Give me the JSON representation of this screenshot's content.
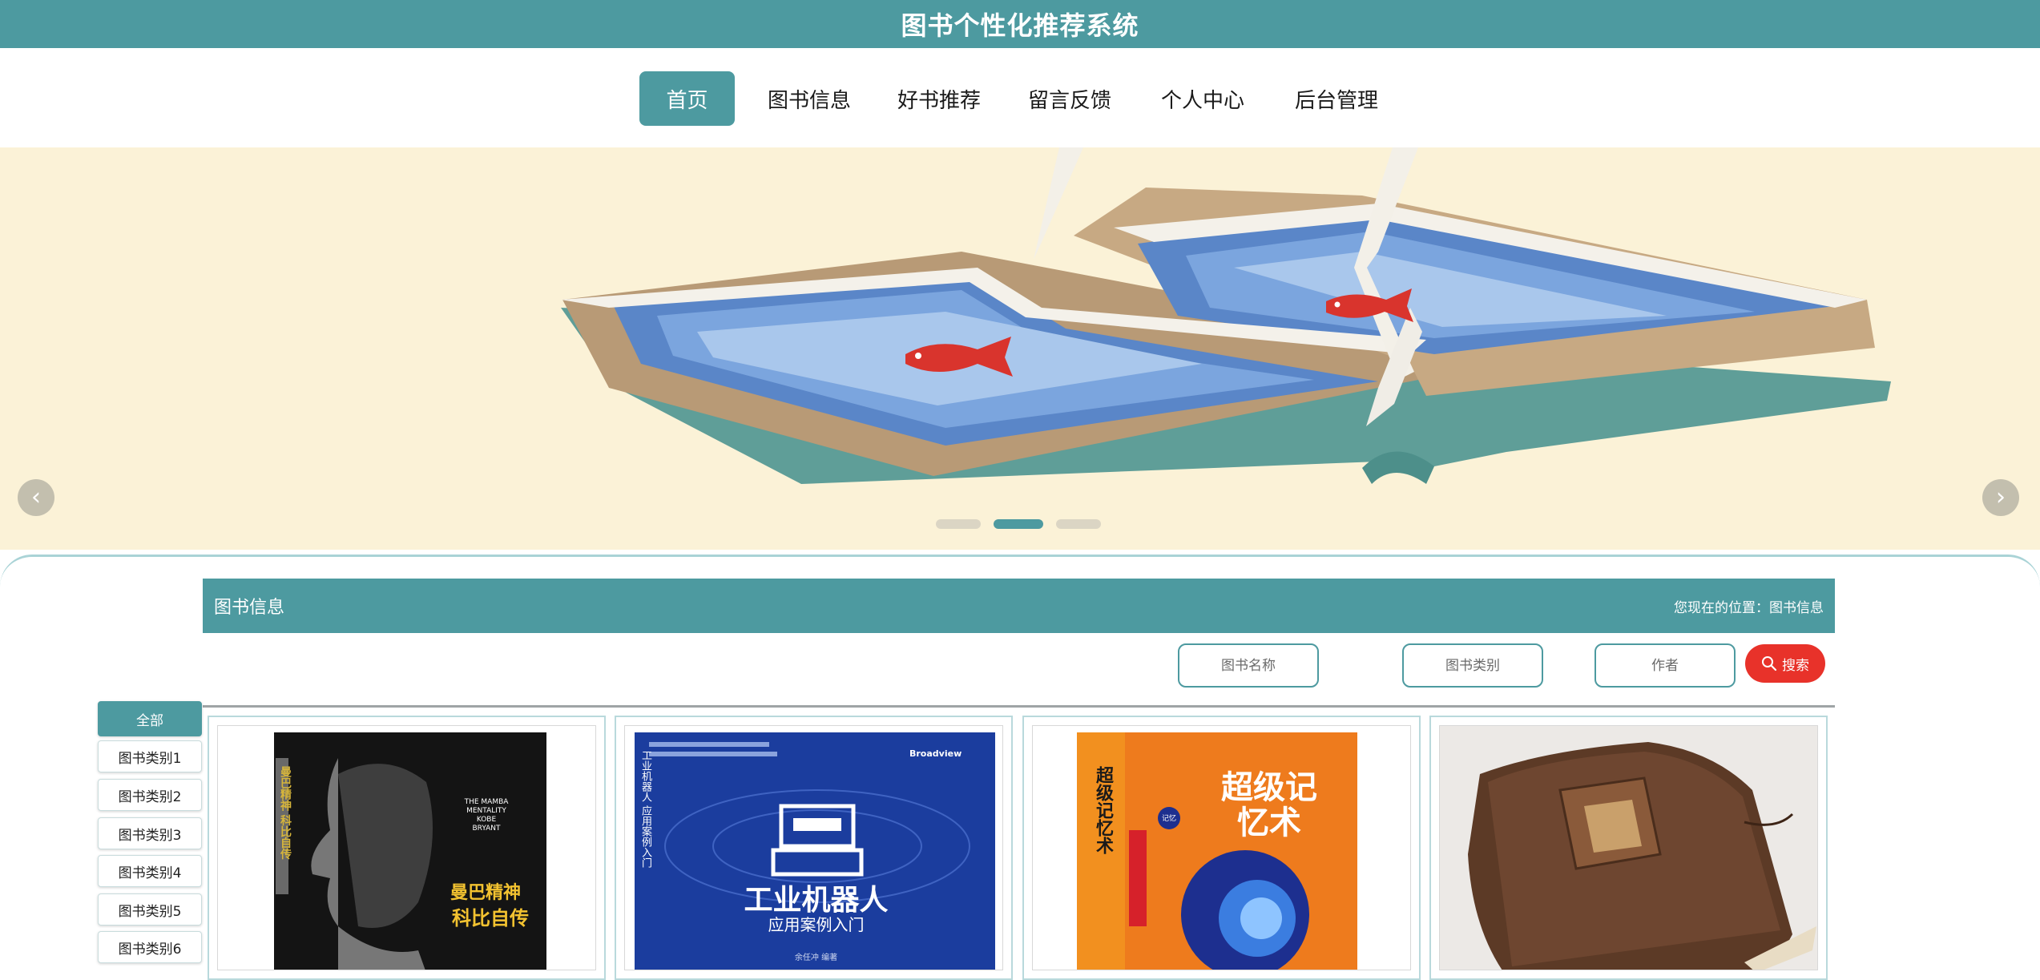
{
  "site": {
    "title": "图书个性化推荐系统"
  },
  "nav": {
    "items": [
      {
        "label": "首页",
        "active": true
      },
      {
        "label": "图书信息",
        "active": false
      },
      {
        "label": "好书推荐",
        "active": false
      },
      {
        "label": "留言反馈",
        "active": false
      },
      {
        "label": "个人中心",
        "active": false
      },
      {
        "label": "后台管理",
        "active": false
      }
    ]
  },
  "banner": {
    "prev_icon": "chevron-left-icon",
    "next_icon": "chevron-right-icon",
    "slide_count": 3,
    "active_slide": 2
  },
  "section": {
    "title": "图书信息",
    "breadcrumb": "您现在的位置：图书信息"
  },
  "search": {
    "name_placeholder": "图书名称",
    "category_placeholder": "图书类别",
    "author_placeholder": "作者",
    "button_label": "搜索",
    "button_icon": "search-icon"
  },
  "categories": [
    "全部",
    "图书类别1",
    "图书类别2",
    "图书类别3",
    "图书类别4",
    "图书类别5",
    "图书类别6"
  ],
  "books": [
    {
      "cover": {
        "side_title": "曼巴精神 科比自传",
        "mini_caption": "THE MAMBA MENTALITY KOBE BRYANT",
        "gold_title": "曼巴精神",
        "main_title": "科比自传"
      }
    },
    {
      "cover": {
        "side_title": "工业机器人 应用案例入门",
        "main_title": "工业机器人",
        "subtitle": "应用案例入门",
        "author": "余任冲 编著",
        "brand": "Broadview"
      }
    },
    {
      "cover": {
        "main_title": "超级记忆术",
        "badge": "记忆",
        "side_title": "超级记忆术"
      }
    },
    {
      "cover": {}
    }
  ],
  "colors": {
    "primary": "#4d9aa0",
    "search_button": "#e8322a",
    "banner_bg": "#fbf2d7"
  }
}
